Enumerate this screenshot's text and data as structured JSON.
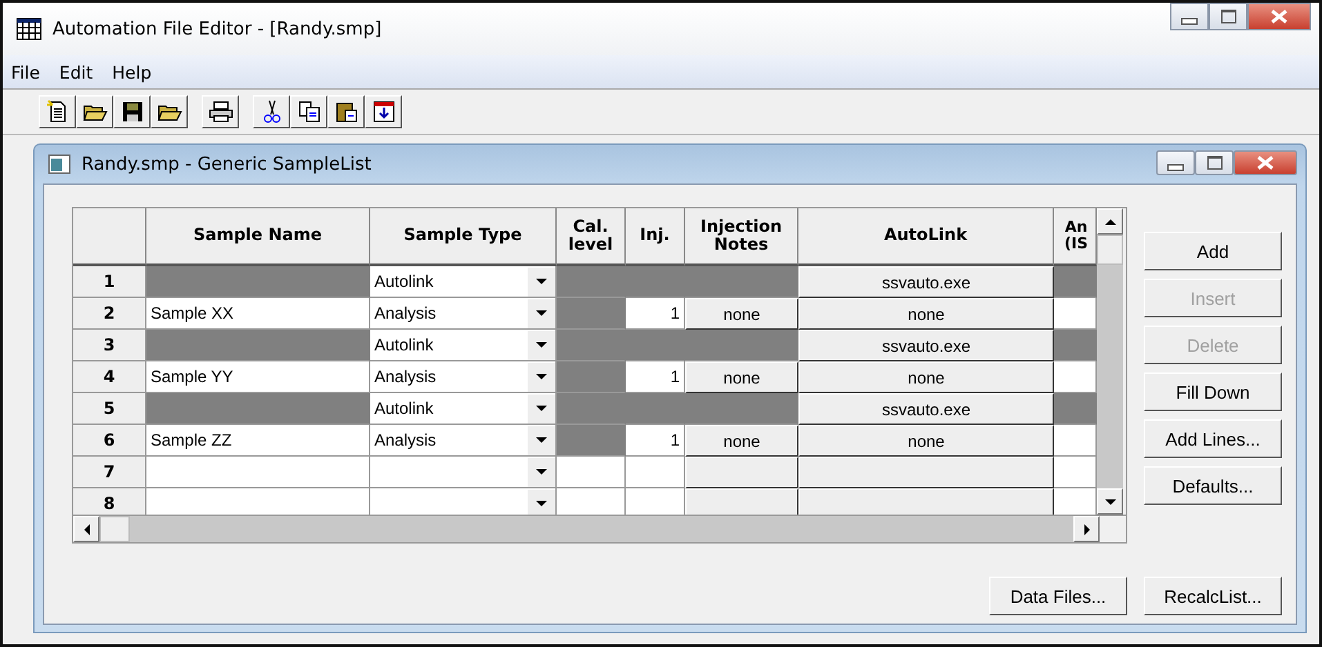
{
  "window": {
    "title": "Automation File Editor - [Randy.smp]"
  },
  "menu": [
    {
      "label": "File"
    },
    {
      "label": "Edit"
    },
    {
      "label": "Help"
    }
  ],
  "toolbar": [
    {
      "kind": "new"
    },
    {
      "kind": "open"
    },
    {
      "kind": "save"
    },
    {
      "kind": "open"
    },
    {
      "kind": "sep"
    },
    {
      "kind": "print"
    },
    {
      "kind": "sep"
    },
    {
      "kind": "cut"
    },
    {
      "kind": "copy"
    },
    {
      "kind": "paste"
    },
    {
      "kind": "table"
    }
  ],
  "child_window": {
    "title": "Randy.smp - Generic SampleList"
  },
  "table": {
    "columns": [
      "Sample Name",
      "Sample Type",
      "Cal. level",
      "Inj.",
      "Injection Notes",
      "AutoLink",
      "An (IS"
    ],
    "rows": [
      {
        "number": "1",
        "kind": "autolink",
        "sample_type": "Autolink",
        "autolink": "ssvauto.exe"
      },
      {
        "number": "2",
        "kind": "analysis",
        "sample_name": "Sample XX",
        "sample_type": "Analysis",
        "inj": "1",
        "notes": "none",
        "autolink": "none"
      },
      {
        "number": "3",
        "kind": "autolink",
        "sample_type": "Autolink",
        "autolink": "ssvauto.exe"
      },
      {
        "number": "4",
        "kind": "analysis",
        "sample_name": "Sample YY",
        "sample_type": "Analysis",
        "inj": "1",
        "notes": "none",
        "autolink": "none"
      },
      {
        "number": "5",
        "kind": "autolink",
        "sample_type": "Autolink",
        "autolink": "ssvauto.exe"
      },
      {
        "number": "6",
        "kind": "analysis",
        "sample_name": "Sample ZZ",
        "sample_type": "Analysis",
        "inj": "1",
        "notes": "none",
        "autolink": "none"
      },
      {
        "number": "7",
        "kind": "blank"
      },
      {
        "number": "8",
        "kind": "blank"
      }
    ]
  },
  "side_buttons": [
    {
      "label": "Add",
      "disabled": false
    },
    {
      "label": "Insert",
      "disabled": true
    },
    {
      "label": "Delete",
      "disabled": true
    },
    {
      "label": "Fill Down",
      "disabled": false
    },
    {
      "label": "Add Lines...",
      "disabled": false
    },
    {
      "label": "Defaults...",
      "disabled": false
    }
  ],
  "bottom_buttons": [
    {
      "label": "Data Files...",
      "disabled": false
    },
    {
      "label": "RecalcList...",
      "disabled": false
    }
  ]
}
